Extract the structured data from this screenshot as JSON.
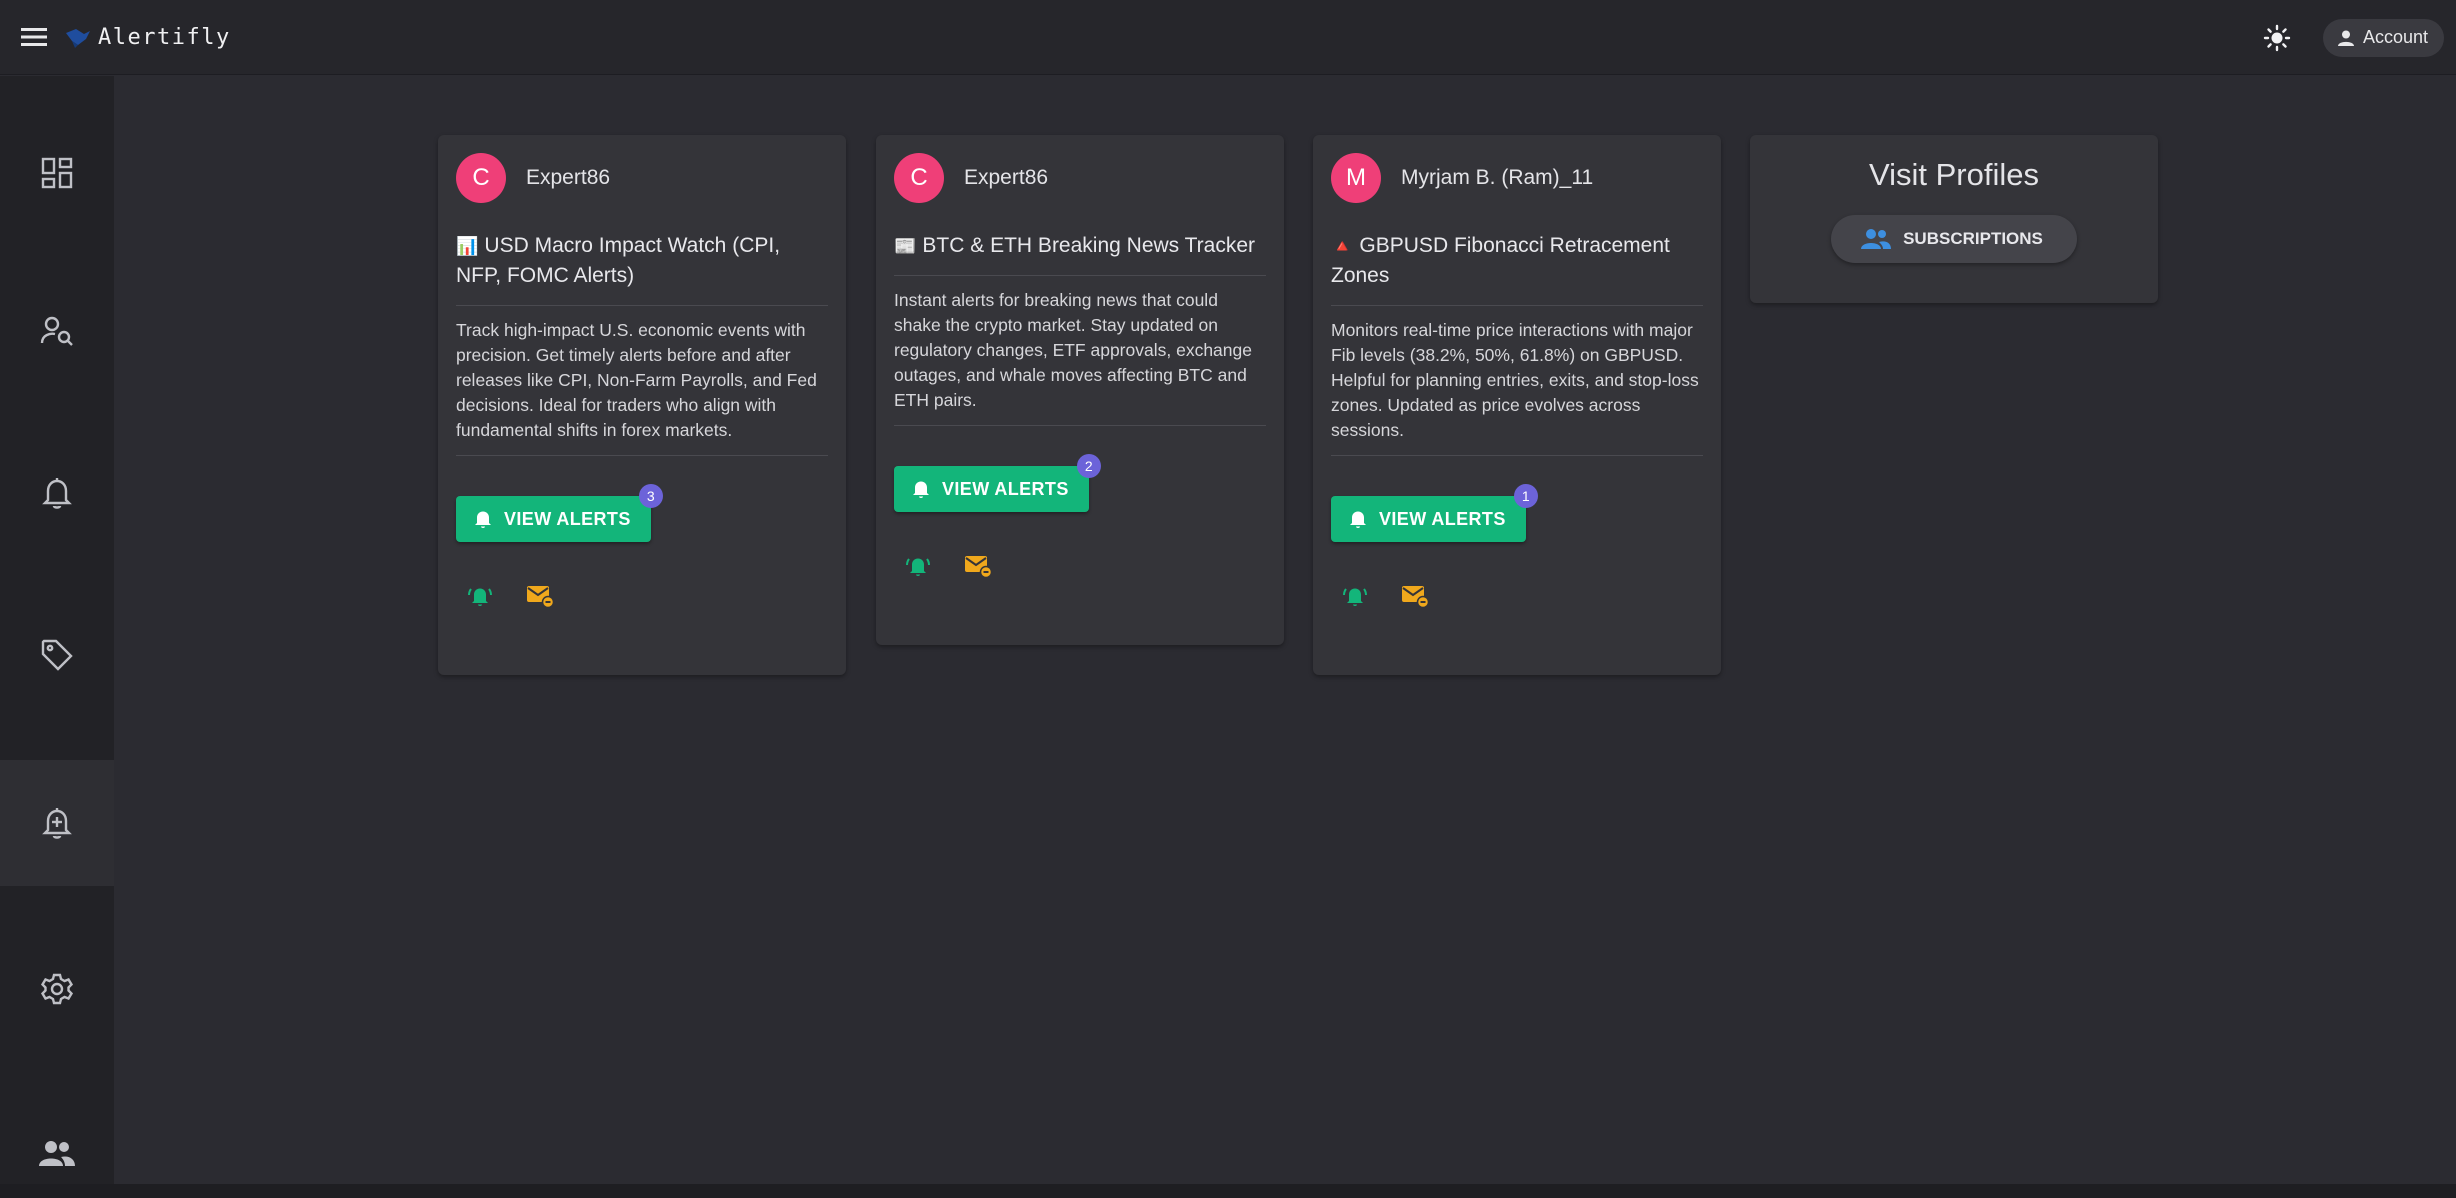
{
  "app": {
    "name": "Alertifly"
  },
  "header": {
    "account_label": "Account"
  },
  "sidebar": {
    "items": [
      {
        "icon": "dashboard-icon"
      },
      {
        "icon": "user-search-icon"
      },
      {
        "icon": "bell-icon"
      },
      {
        "icon": "tag-icon"
      },
      {
        "icon": "bell-plus-icon",
        "active": true
      },
      {
        "icon": "gear-icon"
      },
      {
        "icon": "people-icon"
      }
    ]
  },
  "cards": [
    {
      "avatar_letter": "C",
      "author": "Expert86",
      "title_emoji": "📊",
      "title": "USD Macro Impact Watch (CPI, NFP, FOMC Alerts)",
      "description": "Track high-impact U.S. economic events with precision. Get timely alerts before and after releases like CPI, Non-Farm Payrolls, and Fed decisions. Ideal for traders who align with fundamental shifts in forex markets.",
      "button_label": "VIEW ALERTS",
      "badge": "3"
    },
    {
      "avatar_letter": "C",
      "author": "Expert86",
      "title_emoji": "📰",
      "title": "BTC & ETH Breaking News Tracker",
      "description": "Instant alerts for breaking news that could shake the crypto market. Stay updated on regulatory changes, ETF approvals, exchange outages, and whale moves affecting BTC and ETH pairs.",
      "button_label": "VIEW ALERTS",
      "badge": "2"
    },
    {
      "avatar_letter": "M",
      "author": "Myrjam B. (Ram)_11",
      "title_emoji": "🔺",
      "title": "GBPUSD Fibonacci Retracement Zones",
      "description": "Monitors real-time price interactions with major Fib levels (38.2%, 50%, 61.8%) on GBPUSD. Helpful for planning entries, exits, and stop-loss zones. Updated as price evolves across sessions.",
      "button_label": "VIEW ALERTS",
      "badge": "1"
    }
  ],
  "visit_profiles": {
    "title": "Visit Profiles",
    "button_label": "SUBSCRIPTIONS"
  },
  "colors": {
    "accent_green": "#13b57a",
    "avatar_pink": "#ef3f78",
    "badge_purple": "#6c63d9",
    "mail_orange": "#f0a81c",
    "people_blue": "#3d8fe0"
  }
}
